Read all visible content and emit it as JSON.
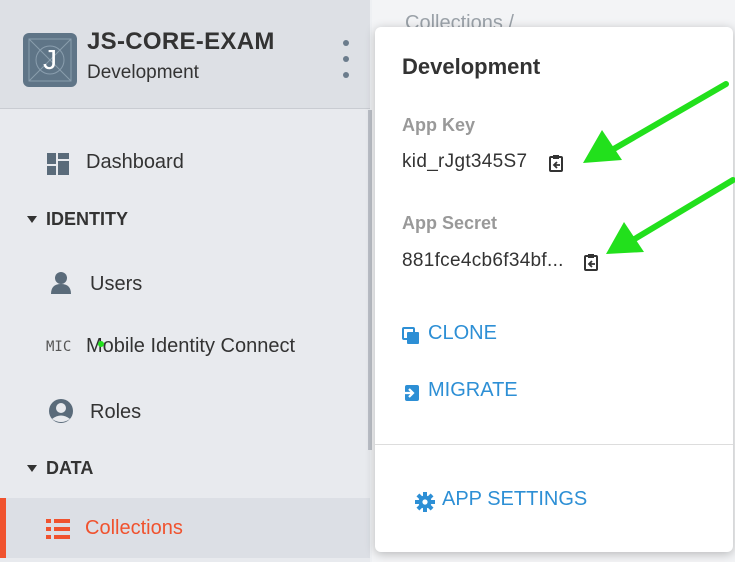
{
  "app": {
    "title": "JS-CORE-EXAM",
    "environment": "Development",
    "logo_letter": "J"
  },
  "breadcrumb": "Collections  /",
  "nav": {
    "dashboard": "Dashboard",
    "identity_section": "IDENTITY",
    "users": "Users",
    "mic_badge": "MIC",
    "mobile_identity": "Mobile Identity Connect",
    "roles": "Roles",
    "data_section": "DATA",
    "collections": "Collections"
  },
  "popup": {
    "title": "Development",
    "app_key_label": "App Key",
    "app_key_value": "kid_rJgt345S7",
    "app_secret_label": "App Secret",
    "app_secret_value": "881fce4cb6f34bf...",
    "clone_label": "CLONE",
    "migrate_label": "MIGRATE",
    "settings_label": "APP SETTINGS"
  },
  "colors": {
    "accent_blue": "#2d8fd5",
    "active_orange": "#f0522e",
    "annotation_green": "#22e01c"
  }
}
